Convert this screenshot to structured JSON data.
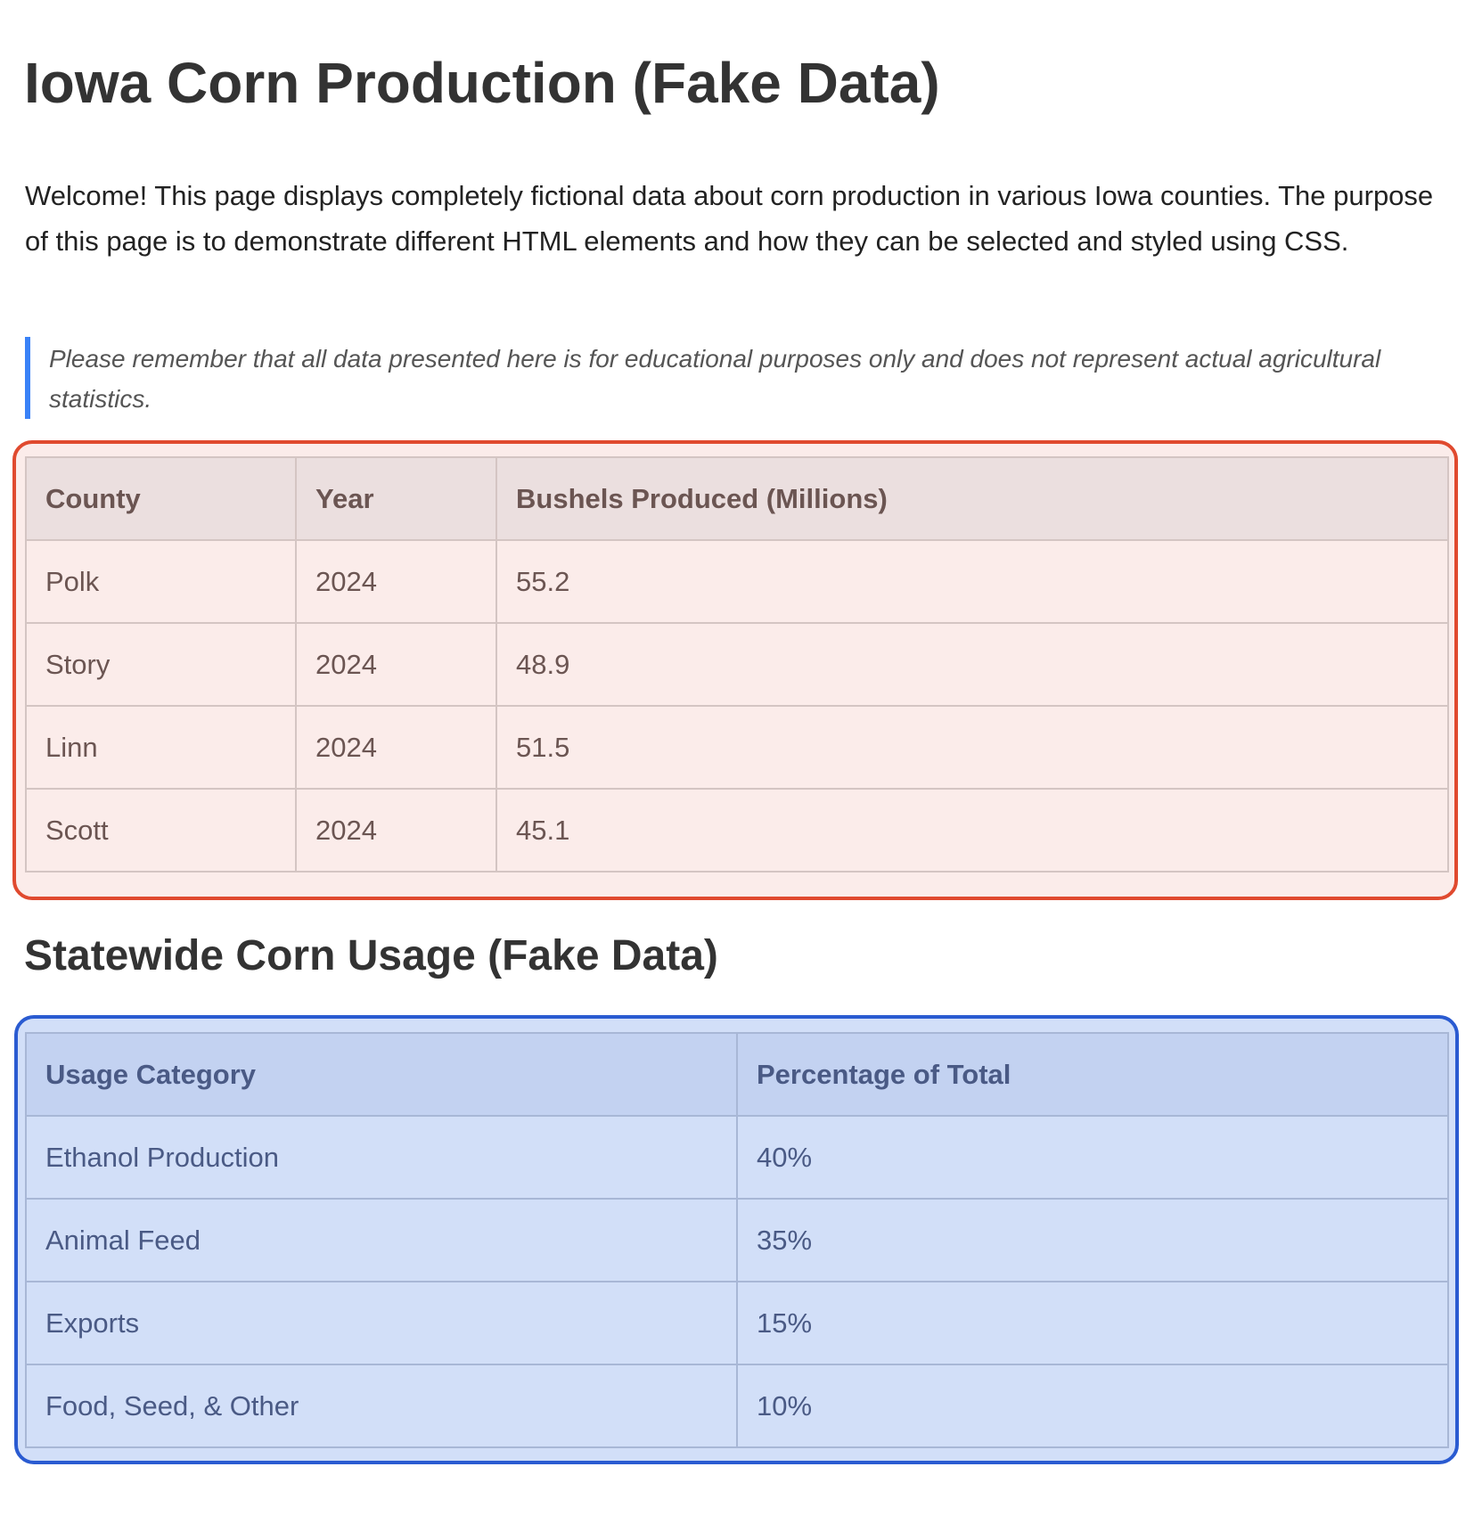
{
  "page": {
    "title": "Iowa Corn Production (Fake Data)",
    "intro": "Welcome! This page displays completely fictional data about corn production in various Iowa counties. The purpose of this page is to demonstrate different HTML elements and how they can be selected and styled using CSS.",
    "note": "Please remember that all data presented here is for educational purposes only and does not represent actual agricultural statistics."
  },
  "production_table": {
    "border_color": "#e04a2f",
    "background": "#fbecea",
    "headers": [
      "County",
      "Year",
      "Bushels Produced (Millions)"
    ],
    "rows": [
      [
        "Polk",
        "2024",
        "55.2"
      ],
      [
        "Story",
        "2024",
        "48.9"
      ],
      [
        "Linn",
        "2024",
        "51.5"
      ],
      [
        "Scott",
        "2024",
        "45.1"
      ]
    ]
  },
  "usage_section": {
    "title": "Statewide Corn Usage (Fake Data)"
  },
  "usage_table": {
    "border_color": "#2a5bd1",
    "background": "#d2dff8",
    "headers": [
      "Usage Category",
      "Percentage of Total"
    ],
    "rows": [
      [
        "Ethanol Production",
        "40%"
      ],
      [
        "Animal Feed",
        "35%"
      ],
      [
        "Exports",
        "15%"
      ],
      [
        "Food, Seed, & Other",
        "10%"
      ]
    ]
  },
  "colors": {
    "note_accent": "#3a82f7",
    "text": "#333333"
  }
}
